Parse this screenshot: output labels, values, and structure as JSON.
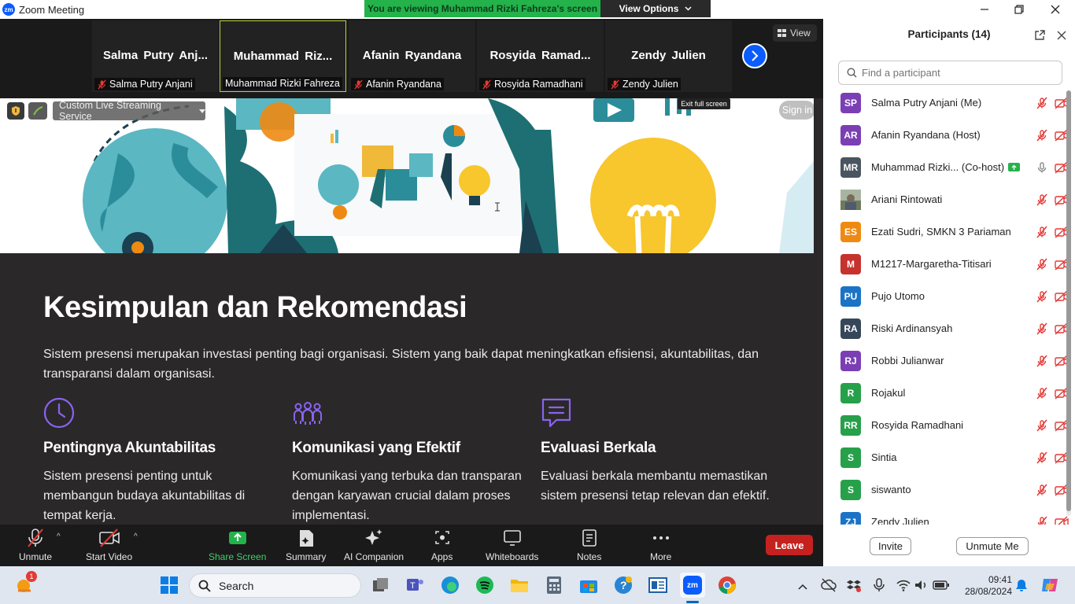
{
  "window": {
    "title": "Zoom Meeting"
  },
  "banner": {
    "message": "You are viewing Muhammad Rizki Fahreza's screen",
    "options_label": "View Options"
  },
  "gallery": {
    "view_label": "View",
    "tiles": [
      {
        "display": "Salma  Putry  Anj...",
        "label": "Salma Putry Anjani",
        "muted": true
      },
      {
        "display": "Muhammad  Riz...",
        "label": "Muhammad Rizki Fahreza",
        "muted": false,
        "active": true
      },
      {
        "display": "Afanin Ryandana",
        "label": "Afanin Ryandana",
        "muted": true
      },
      {
        "display": "Rosyida  Ramad...",
        "label": "Rosyida Ramadhani",
        "muted": true
      },
      {
        "display": "Zendy Julien",
        "label": "Zendy Julien",
        "muted": true
      }
    ]
  },
  "share": {
    "streaming_label": "Custom Live Streaming Service",
    "signin_label": "Sign in",
    "exit_fullscreen_tooltip": "Exit full screen",
    "title": "Kesimpulan dan Rekomendasi",
    "intro": "Sistem presensi merupakan investasi penting bagi organisasi. Sistem yang baik dapat meningkatkan efisiensi, akuntabilitas, dan transparansi dalam organisasi.",
    "columns": [
      {
        "icon": "clock-icon",
        "heading": "Pentingnya Akuntabilitas",
        "text": "Sistem presensi penting untuk membangun budaya akuntabilitas di tempat kerja."
      },
      {
        "icon": "people-icon",
        "heading": "Komunikasi yang Efektif",
        "text": "Komunikasi yang terbuka dan transparan dengan karyawan crucial dalam proses implementasi."
      },
      {
        "icon": "chat-icon",
        "heading": "Evaluasi Berkala",
        "text": "Evaluasi berkala membantu memastikan sistem presensi tetap relevan dan efektif."
      }
    ]
  },
  "participants": {
    "title": "Participants (14)",
    "search_placeholder": "Find a participant",
    "invite_label": "Invite",
    "unmute_me_label": "Unmute Me",
    "list": [
      {
        "initials": "SP",
        "color": "#7b3fb5",
        "name": "Salma Putry Anjani (Me)"
      },
      {
        "initials": "AR",
        "color": "#7b3fb5",
        "name": "Afanin Ryandana (Host)"
      },
      {
        "initials": "MR",
        "color": "#4a5560",
        "name": "Muhammad Rizki... (Co-host)",
        "sharing": true
      },
      {
        "initials": "",
        "color": "#8a8f6a",
        "name": "Ariani Rintowati",
        "photo": true
      },
      {
        "initials": "ES",
        "color": "#ee8a12",
        "name": "Ezati Sudri, SMKN 3 Pariaman"
      },
      {
        "initials": "M",
        "color": "#c6322e",
        "name": "M1217-Margaretha-Titisari"
      },
      {
        "initials": "PU",
        "color": "#1c73c6",
        "name": "Pujo Utomo"
      },
      {
        "initials": "RA",
        "color": "#37475a",
        "name": "Riski Ardinansyah"
      },
      {
        "initials": "RJ",
        "color": "#7b3fb5",
        "name": "Robbi Julianwar"
      },
      {
        "initials": "R",
        "color": "#27a04a",
        "name": "Rojakul"
      },
      {
        "initials": "RR",
        "color": "#27a04a",
        "name": "Rosyida Ramadhani"
      },
      {
        "initials": "S",
        "color": "#27a04a",
        "name": "Sintia"
      },
      {
        "initials": "S",
        "color": "#27a04a",
        "name": "siswanto"
      },
      {
        "initials": "ZJ",
        "color": "#1c73c6",
        "name": "Zendy Julien"
      }
    ]
  },
  "toolbar": {
    "unmute": "Unmute",
    "start_video": "Start Video",
    "share_screen": "Share Screen",
    "summary": "Summary",
    "ai_companion": "AI Companion",
    "apps": "Apps",
    "whiteboards": "Whiteboards",
    "notes": "Notes",
    "more": "More",
    "leave": "Leave"
  },
  "taskbar": {
    "search_label": "Search",
    "time": "09:41",
    "date": "28/08/2024",
    "widget_badge": "1"
  },
  "colors": {
    "accent": "#0b5cff",
    "share_green": "#24b24b",
    "leave_red": "#c5221f",
    "slide_bg": "#2b2829",
    "icon_purple": "#8a63f0"
  }
}
